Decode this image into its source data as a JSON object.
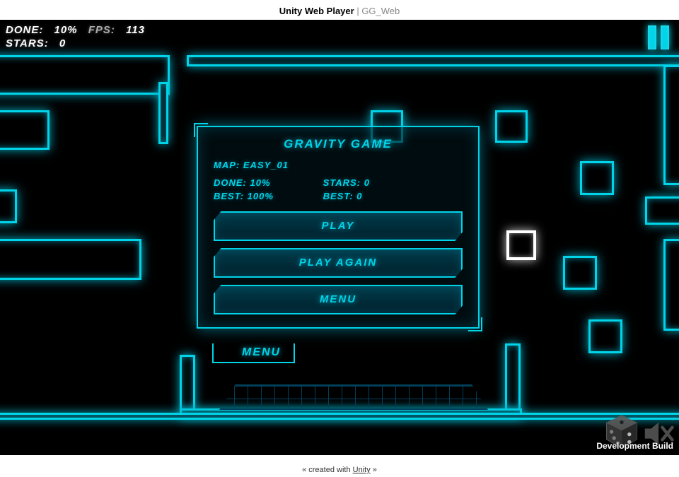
{
  "page": {
    "title_bold": "Unity Web Player",
    "title_sep": " | ",
    "title_light": "GG_Web",
    "footer_prefix": "« created with ",
    "footer_link": "Unity",
    "footer_suffix": " »"
  },
  "hud": {
    "done_label": "DONE:",
    "done_value": "10%",
    "fps_label": "FPS:",
    "fps_value": "113",
    "stars_label": "STARS:",
    "stars_value": "0"
  },
  "menu": {
    "title": "GRAVITY GAME",
    "map_label": "MAP:",
    "map_name": "EASY_01",
    "done_label": "DONE:",
    "done_value": "10%",
    "stars_label": "STARS:",
    "stars_value": "0",
    "best_done_label": "BEST:",
    "best_done_value": "100%",
    "best_stars_label": "BEST:",
    "best_stars_value": "0",
    "buttons": {
      "play": "PLAY",
      "play_again": "PLAY AGAIN",
      "menu": "MENU"
    },
    "footer_label": "MENU"
  },
  "dev": {
    "label": "Development Build"
  }
}
